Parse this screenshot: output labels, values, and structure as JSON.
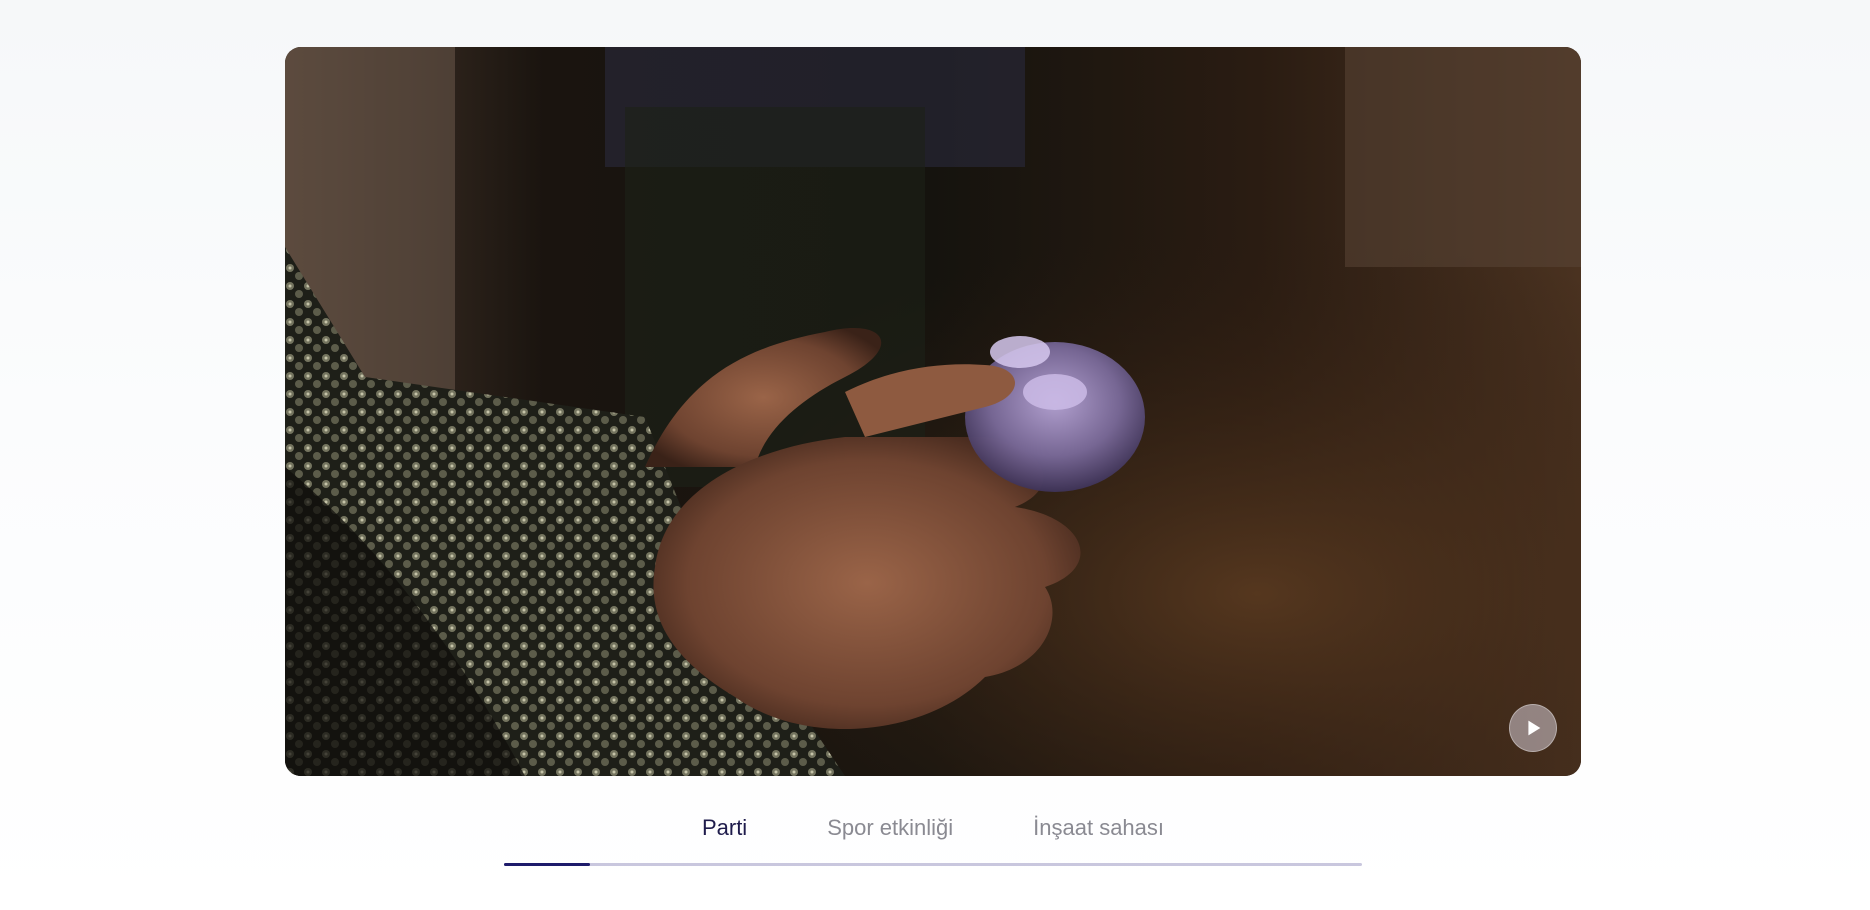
{
  "video": {
    "playing": false,
    "play_icon": "play-icon"
  },
  "tabs": {
    "items": [
      {
        "label": "Parti",
        "active": true
      },
      {
        "label": "Spor etkinliği",
        "active": false
      },
      {
        "label": "İnşaat sahası",
        "active": false
      }
    ],
    "progress_fraction": 0.1
  },
  "colors": {
    "active_tab": "#1e1b4b",
    "inactive_tab": "#8a8a92",
    "progress_fill": "#1e1b6b",
    "progress_track": "#c9c7de"
  }
}
